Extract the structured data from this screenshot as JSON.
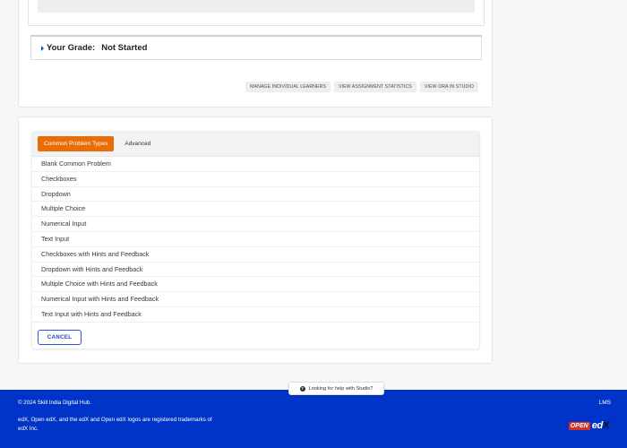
{
  "ora": {
    "grade_label": "Your Grade:",
    "grade_value": "Not Started",
    "actions": {
      "manage": "MANAGE INDIVIDUAL LEARNERS",
      "stats": "VIEW ASSIGNMENT STATISTICS",
      "studio": "VIEW ORA IN STUDIO"
    }
  },
  "problem": {
    "tabs": {
      "common": "Common Problem Types",
      "advanced": "Advanced"
    },
    "items": [
      "Blank Common Problem",
      "Checkboxes",
      "Dropdown",
      "Multiple Choice",
      "Numerical Input",
      "Text Input",
      "Checkboxes with Hints and Feedback",
      "Dropdown with Hints and Feedback",
      "Multiple Choice with Hints and Feedback",
      "Numerical Input with Hints and Feedback",
      "Text Input with Hints and Feedback"
    ],
    "cancel_label": "CANCEL"
  },
  "help": {
    "label": "Looking for help with Studio?",
    "icon_glyph": "?"
  },
  "footer": {
    "copyright": "© 2024 Skill India Digital Hub.",
    "trademark": "edX, Open edX, and the edX and Open edX logos are registered trademarks of edX Inc.",
    "lms_link": "LMS",
    "logo_open": "OPEN",
    "logo_ed": "ed",
    "logo_x": "X"
  },
  "colors": {
    "accent": "#e86d08",
    "footer_bg": "#0034c8",
    "cancel": "#1e45c7"
  }
}
